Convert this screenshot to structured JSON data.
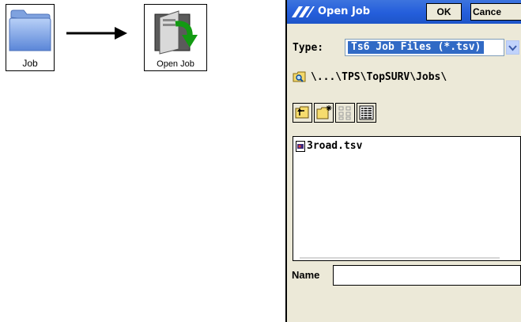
{
  "launcher": {
    "job_label": "Job",
    "open_job_label": "Open Job"
  },
  "dialog": {
    "title": "Open Job",
    "ok_label": "OK",
    "cancel_label": "Cance",
    "type_label": "Type:",
    "type_value": "Ts6 Job Files (*.tsv)",
    "path": "\\...\\TPS\\TopSURV\\Jobs\\",
    "files": [
      "3road.tsv"
    ],
    "name_label": "Name",
    "name_value": ""
  },
  "colors": {
    "title_bar": "#245edb",
    "dialog_bg": "#ece9d8",
    "selection": "#316ac5",
    "folder_blue": "#8fb3ee"
  }
}
